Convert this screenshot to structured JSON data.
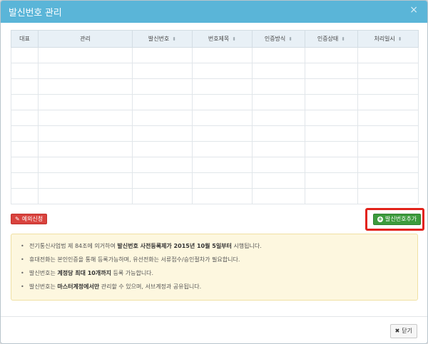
{
  "modal": {
    "title": "발신번호 관리",
    "close_icon_glyph": "×"
  },
  "table": {
    "columns": [
      {
        "label": "대표",
        "sortable": false
      },
      {
        "label": "관리",
        "sortable": false
      },
      {
        "label": "발신번호",
        "sortable": true
      },
      {
        "label": "번호제목",
        "sortable": true
      },
      {
        "label": "인증방식",
        "sortable": true
      },
      {
        "label": "인증상태",
        "sortable": true
      },
      {
        "label": "처리일시",
        "sortable": true
      }
    ],
    "empty_rows": 10
  },
  "buttons": {
    "exception_label": "예외신청",
    "add_label": "발신번호추가",
    "close_label": "닫기"
  },
  "notice": [
    {
      "parts": [
        {
          "t": "전기통신사업법 제 84조에 의거하여 "
        },
        {
          "t": "발신번호 사전등록제가 2015년 10월 5일부터",
          "b": true
        },
        {
          "t": " 시행됩니다."
        }
      ]
    },
    {
      "parts": [
        {
          "t": "휴대전화는 본인인증을 통해 등록가능하며, 유선전화는 서류접수/승인절차가 필요합니다."
        }
      ]
    },
    {
      "parts": [
        {
          "t": "발신번호는 "
        },
        {
          "t": "계정당 최대 10개까지",
          "b": true
        },
        {
          "t": " 등록 가능합니다."
        }
      ]
    },
    {
      "parts": [
        {
          "t": "발신번호는 "
        },
        {
          "t": "마스터계정에서만",
          "b": true
        },
        {
          "t": " 관리할 수 있으며, 서브계정과 공유됩니다."
        }
      ]
    }
  ],
  "colors": {
    "header": "#5ab5d8",
    "exception_button": "#d9433e",
    "add_button": "#3d9b3d",
    "highlight": "#e2231a",
    "notice_bg": "#fdf7df"
  }
}
